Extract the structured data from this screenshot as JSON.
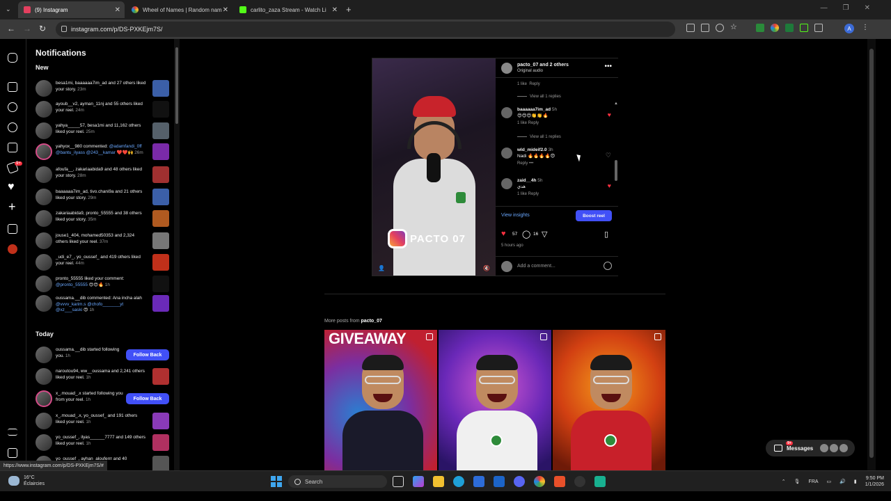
{
  "browser": {
    "tabs": [
      {
        "title": "(9) Instagram",
        "active": true,
        "color": "#e4405f"
      },
      {
        "title": "Wheel of Names | Random nam",
        "active": false,
        "color": "#4caf50"
      },
      {
        "title": "carlito_zaza Stream - Watch Li",
        "active": false,
        "color": "#53fc18"
      }
    ],
    "url": "instagram.com/p/DS-PXKEjm7S/",
    "profile_initial": "A",
    "status_url": "https://www.instagram.com/p/DS-PXKEjm7S/#"
  },
  "sidebar": {
    "notification_badge": "9+"
  },
  "notifications": {
    "title": "Notifications",
    "section_new": "New",
    "section_today": "Today",
    "new_items": [
      {
        "text": "besa1mi, baaaaaa7im_ad and 27 others liked your story.",
        "time": "23m",
        "thumb": "#3b5fa8"
      },
      {
        "text": "ayoub__v2, ayman_11nj and 55 others liked your reel.",
        "time": "24m",
        "thumb": "#111111"
      },
      {
        "text": "yahya_____57, besa1mi and 11,162 others liked your reel.",
        "time": "25m",
        "thumb": "#55606a"
      },
      {
        "text": "yahyox__980 commented: @adamfandi_0ff @bantu_ilyass @243__kamar ❤️❤️🙌",
        "time": "26m",
        "thumb": "#7a2aa8"
      },
      {
        "text": "afoufa__, zakariaabida9 and 48 others liked your story.",
        "time": "28m",
        "thumb": "#a03030"
      },
      {
        "text": "baaaaaa7im_ad, tivo.chani9a and 21 others liked your story.",
        "time": "29m",
        "thumb": "#3b5fa8"
      },
      {
        "text": "zakariaabida9, pronto_55555 and 38 others liked your story.",
        "time": "35m",
        "thumb": "#b05a20"
      },
      {
        "text": "jouse1_404, mohamed50353 and 2,324 others liked your reel.",
        "time": "37m",
        "thumb": "#777777"
      },
      {
        "text": "_udi_e7_, yo_oussef_ and 419 others liked your reel.",
        "time": "44m",
        "thumb": "#c0301a"
      },
      {
        "text": "pronto_55555 liked your comment: @pronto_55555 😍😍🔥",
        "time": "1h",
        "thumb": "#111111"
      },
      {
        "text": "oussama.__dib commented: Ana incha alah @vvvv_karim.s @chofo_______yt @xz___saski 😍",
        "time": "1h",
        "thumb": "#6a2ab8"
      }
    ],
    "today_items": [
      {
        "text": "oussama.__dib started following you.",
        "time": "1h",
        "follow": true
      },
      {
        "text": "naroutou94, ww__oussama and 2,241 others liked your reel.",
        "time": "1h",
        "follow": false,
        "thumb": "#b03030"
      },
      {
        "text": "x_.mouad_.x started following you from your reel.",
        "time": "1h",
        "follow": true
      },
      {
        "text": "x_.mouad_.x, yo_oussef_ and 191 others liked your reel.",
        "time": "1h",
        "follow": false,
        "thumb": "#8a3ab8"
      },
      {
        "text": "yo_oussef_, ilyas______7777 and 149 others liked your reel.",
        "time": "1h",
        "follow": false,
        "thumb": "#b03060"
      },
      {
        "text": "yo_oussef_, ayhan_alouferrr and 40",
        "time": "",
        "follow": false,
        "thumb": "#555555"
      }
    ],
    "follow_back_label": "Follow Back"
  },
  "post": {
    "header_user": "pacto_07 and 2 others",
    "header_audio": "Original audio",
    "watermark": "PACTO 07",
    "top_like": "1 like",
    "top_reply": "Reply",
    "view_replies": "View all 1 replies",
    "comments": [
      {
        "user": "baaaaaa7im_ad",
        "time": "5h",
        "text": "😍😍😍👏👏🔥",
        "meta": "1 like  Reply",
        "liked": true
      },
      {
        "user": "wld_mideif2.0",
        "time": "3h",
        "text": "Nadi 🔥🔥🔥🔥😍",
        "meta": "Reply  •••",
        "liked": false
      },
      {
        "user": "zaid__4h",
        "time": "5h",
        "text": "هدي",
        "meta": "1 like  Reply",
        "liked": true
      }
    ],
    "view_insights": "View insights",
    "boost_post": "Boost reel",
    "likes_count": "57",
    "comments_count": "16",
    "post_time": "5 hours ago",
    "add_comment_placeholder": "Add a comment..."
  },
  "more_posts": {
    "label_prefix": "More posts from",
    "user": "pacto_07",
    "items": [
      {
        "caption": "GIVEAWAY",
        "shirt": "#1a1a2a"
      },
      {
        "caption": "",
        "shirt": "#f0f0f0"
      },
      {
        "caption": "",
        "shirt": "#c8202a"
      }
    ]
  },
  "messages": {
    "label": "Messages",
    "badge": "9+"
  },
  "taskbar": {
    "temperature": "16°C",
    "weather_desc": "Éclaircies",
    "search_placeholder": "Search",
    "language": "FRA",
    "time": "9:50 PM",
    "date": "1/1/2026"
  },
  "colors": {
    "accent_blue": "#4150f7",
    "like_red": "#ff3040",
    "link_blue": "#6aa8ff"
  }
}
